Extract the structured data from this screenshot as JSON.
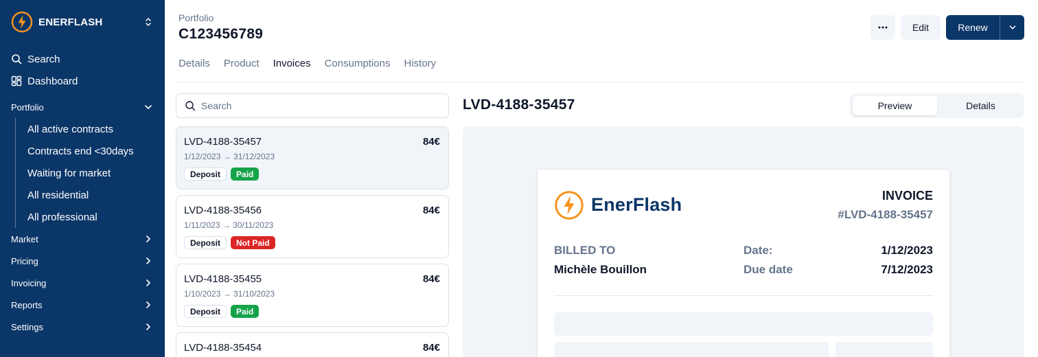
{
  "app": {
    "name": "ENERFLASH",
    "brand_color": "#0b3668",
    "accent_color": "#f7931e"
  },
  "sidebar": {
    "search_label": "Search",
    "dashboard_label": "Dashboard",
    "portfolio_label": "Portfolio",
    "portfolio_items": [
      {
        "label": "All active contracts"
      },
      {
        "label": "Contracts end <30days"
      },
      {
        "label": "Waiting for market"
      },
      {
        "label": "All residential"
      },
      {
        "label": "All professional"
      }
    ],
    "sections": [
      {
        "label": "Market"
      },
      {
        "label": "Pricing"
      },
      {
        "label": "Invoicing"
      },
      {
        "label": "Reports"
      },
      {
        "label": "Settings"
      }
    ]
  },
  "header": {
    "breadcrumb": "Portfolio",
    "title": "C123456789",
    "more_label": "···",
    "edit_label": "Edit",
    "renew_label": "Renew"
  },
  "tabs": [
    {
      "label": "Details",
      "active": false
    },
    {
      "label": "Product",
      "active": false
    },
    {
      "label": "Invoices",
      "active": true
    },
    {
      "label": "Consumptions",
      "active": false
    },
    {
      "label": "History",
      "active": false
    }
  ],
  "invoice_search": {
    "placeholder": "Search"
  },
  "invoices": [
    {
      "number": "LVD-4188-35457",
      "amount": "84€",
      "period": "1/12/2023 → 31/12/2023",
      "type": "Deposit",
      "status": "Paid",
      "selected": true
    },
    {
      "number": "LVD-4188-35456",
      "amount": "84€",
      "period": "1/11/2023 → 30/11/2023",
      "type": "Deposit",
      "status": "Not Paid",
      "selected": false
    },
    {
      "number": "LVD-4188-35455",
      "amount": "84€",
      "period": "1/10/2023 → 31/10/2023",
      "type": "Deposit",
      "status": "Paid",
      "selected": false
    },
    {
      "number": "LVD-4188-35454",
      "amount": "84€"
    }
  ],
  "detail": {
    "title": "LVD-4188-35457",
    "view_options": [
      "Preview",
      "Details"
    ],
    "selected_view": "Preview"
  },
  "document": {
    "brand": "EnerFlash",
    "title": "INVOICE",
    "reference": "#LVD-4188-35457",
    "billed_to_label": "BILLED TO",
    "billed_to_name": "Michèle Bouillon",
    "date_label": "Date:",
    "date_value": "1/12/2023",
    "due_label": "Due date",
    "due_value": "7/12/2023"
  },
  "status_colors": {
    "Paid": "#16a34a",
    "Not Paid": "#dc2626"
  }
}
